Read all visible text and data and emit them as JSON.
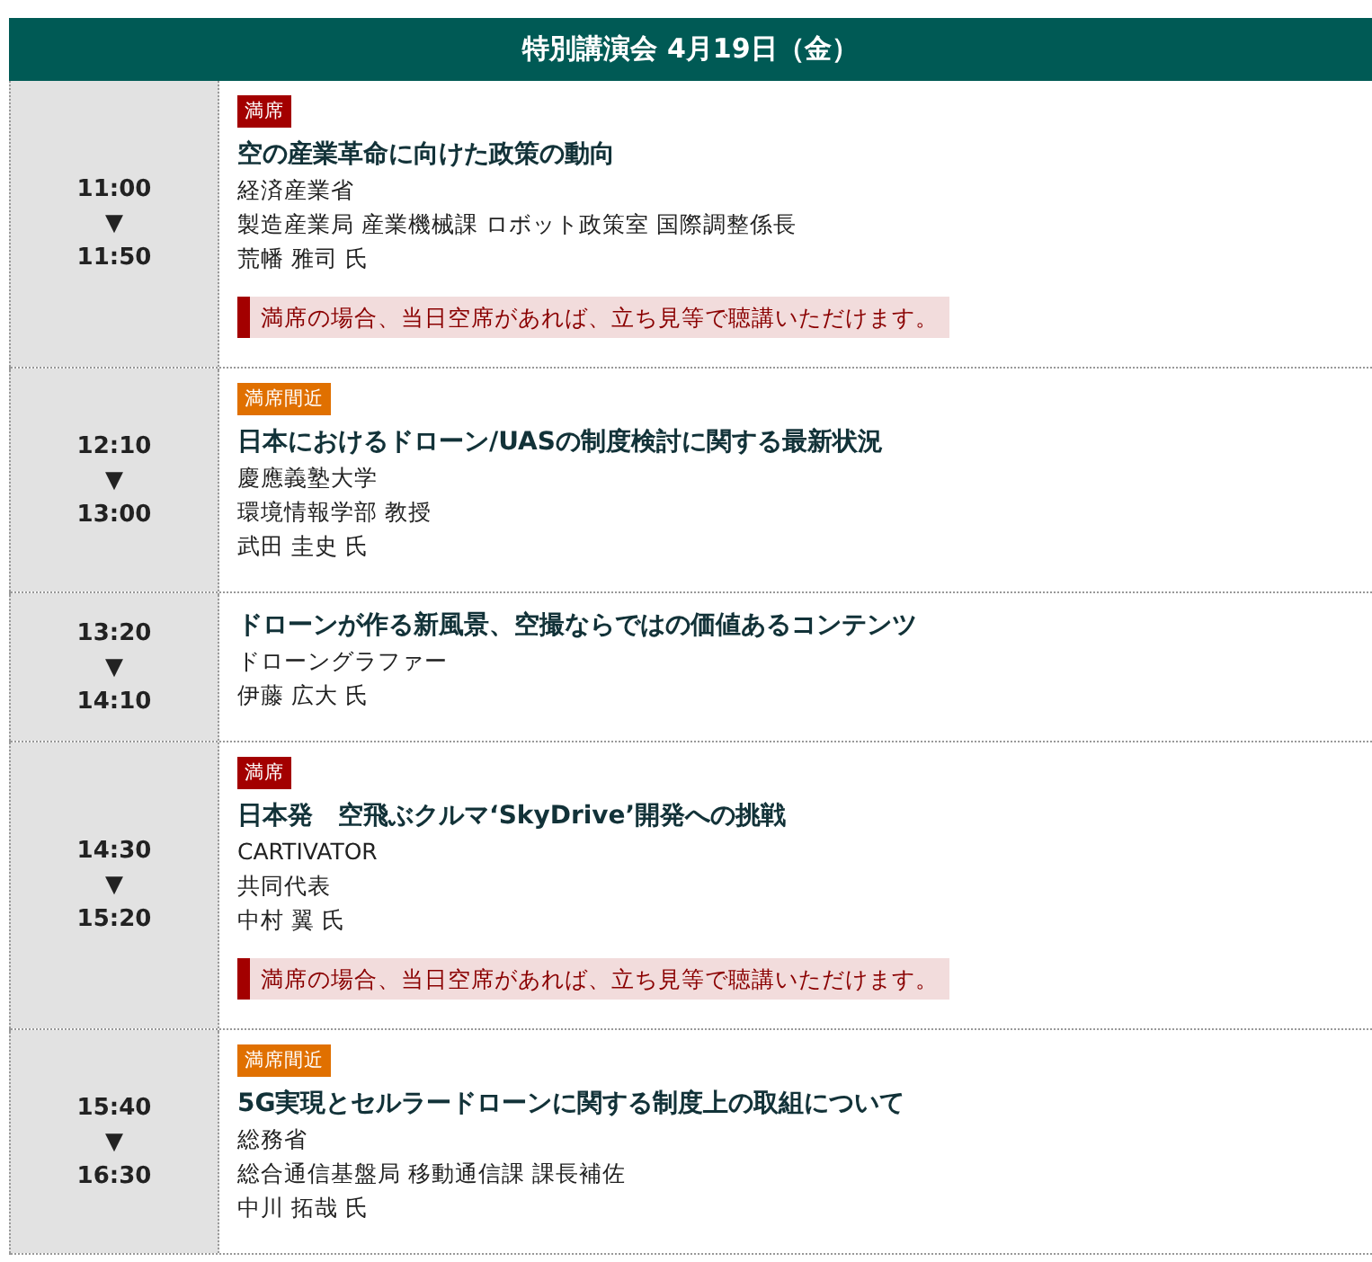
{
  "header": {
    "title": "特別講演会 4月19日（金）"
  },
  "sessions": [
    {
      "start": "11:00",
      "arrow": "▼",
      "end": "11:50",
      "status": {
        "kind": "full",
        "label": "満席"
      },
      "title": "空の産業革命に向けた政策の動向",
      "lines": [
        "経済産業省",
        "製造産業局 産業機械課 ロボット政策室 国際調整係長",
        "荒幡 雅司 氏"
      ],
      "note": "満席の場合、当日空席があれば、立ち見等で聴講いただけます。"
    },
    {
      "start": "12:10",
      "arrow": "▼",
      "end": "13:00",
      "status": {
        "kind": "almost",
        "label": "満席間近"
      },
      "title": "日本におけるドローン/UASの制度検討に関する最新状況",
      "lines": [
        "慶應義塾大学",
        "環境情報学部 教授",
        "武田 圭史 氏"
      ]
    },
    {
      "start": "13:20",
      "arrow": "▼",
      "end": "14:10",
      "title": "ドローンが作る新風景、空撮ならではの価値あるコンテンツ",
      "lines": [
        "ドローングラファー",
        "伊藤 広大 氏"
      ]
    },
    {
      "start": "14:30",
      "arrow": "▼",
      "end": "15:20",
      "status": {
        "kind": "full",
        "label": "満席"
      },
      "title": "日本発　空飛ぶクルマ‘SkyDrive’開発への挑戦",
      "lines": [
        "CARTIVATOR",
        "共同代表",
        "中村 翼 氏"
      ],
      "note": "満席の場合、当日空席があれば、立ち見等で聴講いただけます。"
    },
    {
      "start": "15:40",
      "arrow": "▼",
      "end": "16:30",
      "status": {
        "kind": "almost",
        "label": "満席間近"
      },
      "title": "5G実現とセルラードローンに関する制度上の取組について",
      "lines": [
        "総務省",
        "総合通信基盤局 移動通信課 課長補佐",
        "中川 拓哉 氏"
      ]
    }
  ]
}
